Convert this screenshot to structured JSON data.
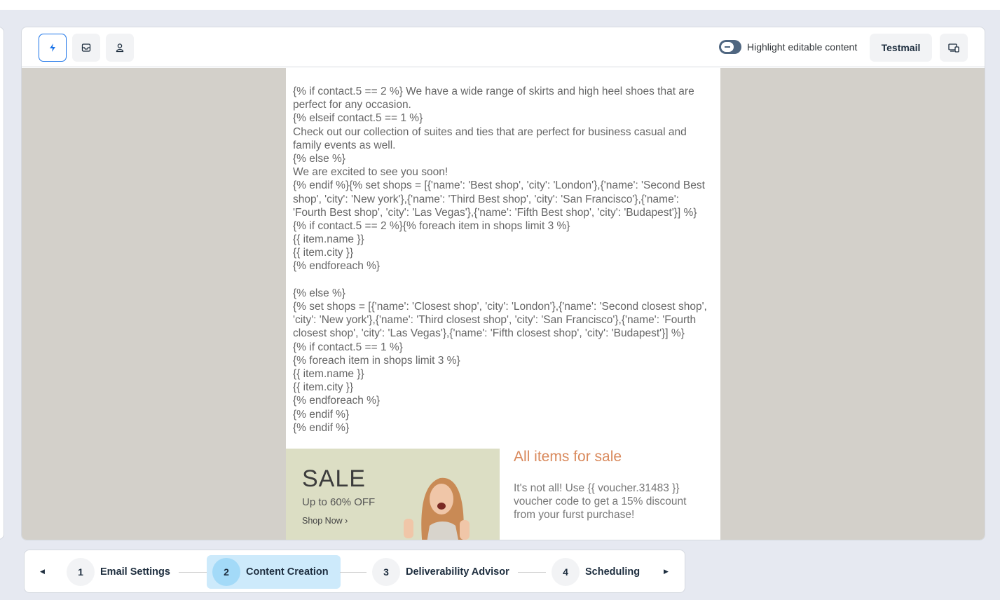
{
  "toolbar": {
    "highlight_label": "Highlight editable content",
    "highlight_on": false,
    "testmail_label": "Testmail",
    "icons": [
      "lightning-icon",
      "inbox-icon",
      "user-icon",
      "device-preview-icon"
    ]
  },
  "email": {
    "code_lines": [
      "{% if contact.5 == 2 %} We have a wide range of skirts and high heel shoes that are",
      "perfect for any occasion.",
      "{% elseif contact.5 == 1 %}",
      "Check out our collection of suites and ties that are perfect for business casual and",
      "family events as well.",
      "{% else %}",
      "We are excited to see you soon!",
      "{% endif %}{% set shops = [{'name': 'Best shop', 'city': 'London'},{'name': 'Second Best",
      "shop', 'city': 'New york'},{'name': 'Third Best shop', 'city': 'San Francisco'},{'name':",
      "'Fourth Best shop', 'city': 'Las Vegas'},{'name': 'Fifth Best shop', 'city': 'Budapest'}] %}",
      "{% if contact.5 == 2 %}{% foreach item in shops limit 3 %}",
      "{{ item.name }}",
      "{{ item.city }}",
      "{% endforeach %}",
      "",
      "{% else %}",
      "{% set shops = [{'name': 'Closest shop', 'city': 'London'},{'name': 'Second closest shop',",
      "'city': 'New york'},{'name': 'Third closest shop', 'city': 'San Francisco'},{'name': 'Fourth",
      "closest shop', 'city': 'Las Vegas'},{'name': 'Fifth closest shop', 'city': 'Budapest'}] %}",
      "{% if contact.5 == 1 %}",
      "{% foreach item in shops limit 3 %}",
      "{{ item.name }}",
      "{{ item.city }}",
      "{% endforeach %}",
      "{% endif %}",
      "{% endif %}"
    ],
    "banner": {
      "sale": "SALE",
      "discount": "Up to 60% OFF",
      "shop_now": "Shop Now ›"
    },
    "promo_title": "All items for sale",
    "promo_text": "It's not all! Use {{ voucher.31483 }} voucher code to get a 15% discount from your furst purchase!",
    "promo_title_color": "#d9895c"
  },
  "stepper": {
    "steps": [
      {
        "number": "1",
        "label": "Email Settings"
      },
      {
        "number": "2",
        "label": "Content Creation",
        "active": true
      },
      {
        "number": "3",
        "label": "Deliverability Advisor"
      },
      {
        "number": "4",
        "label": "Scheduling"
      }
    ]
  }
}
